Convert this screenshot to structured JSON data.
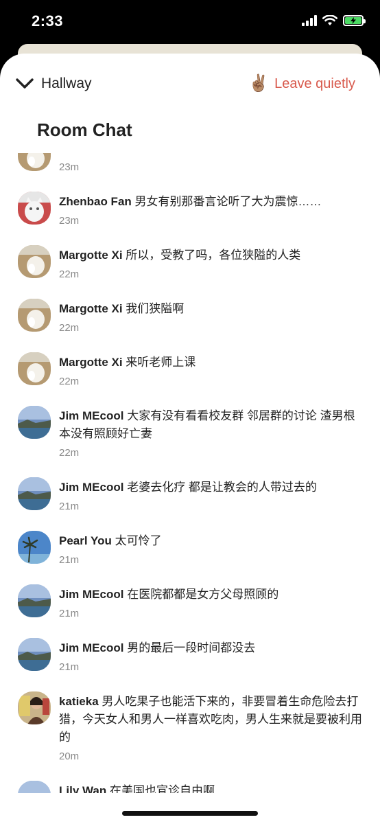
{
  "status": {
    "time": "2:33"
  },
  "header": {
    "back_label": "Hallway",
    "leave_emoji": "✌🏽",
    "leave_label": "Leave quietly",
    "leave_color": "#d8594c"
  },
  "room_title": "Room Chat",
  "messages": [
    {
      "name": "",
      "text": "",
      "time": "23m",
      "avatar": "dog"
    },
    {
      "name": "Zhenbao Fan",
      "text": "男女有别那番言论听了大为震惊……",
      "time": "23m",
      "avatar": "cat"
    },
    {
      "name": "Margotte Xi",
      "text": "所以，受教了吗，各位狭隘的人类",
      "time": "22m",
      "avatar": "dog"
    },
    {
      "name": "Margotte Xi",
      "text": "我们狭隘啊",
      "time": "22m",
      "avatar": "dog"
    },
    {
      "name": "Margotte Xi",
      "text": "来听老师上课",
      "time": "22m",
      "avatar": "dog"
    },
    {
      "name": "Jim MEcool",
      "text": "大家有没有看看校友群 邻居群的讨论 渣男根本没有照顾好亡妻",
      "time": "22m",
      "avatar": "lake"
    },
    {
      "name": "Jim MEcool",
      "text": "老婆去化疗 都是让教会的人带过去的",
      "time": "21m",
      "avatar": "lake"
    },
    {
      "name": "Pearl You",
      "text": "太可怜了",
      "time": "21m",
      "avatar": "palm"
    },
    {
      "name": "Jim MEcool",
      "text": "在医院都都是女方父母照顾的",
      "time": "21m",
      "avatar": "lake"
    },
    {
      "name": "Jim MEcool",
      "text": "男的最后一段时间都没去",
      "time": "21m",
      "avatar": "lake"
    },
    {
      "name": "katieka",
      "text": "男人吃果子也能活下来的，非要冒着生命危险去打猎，今天女人和男人一样喜欢吃肉，男人生来就是要被利用的",
      "time": "20m",
      "avatar": "person"
    },
    {
      "name": "Lily Wan",
      "text": "在美国也宣诊自由啊",
      "time": "",
      "avatar": "lake"
    }
  ]
}
